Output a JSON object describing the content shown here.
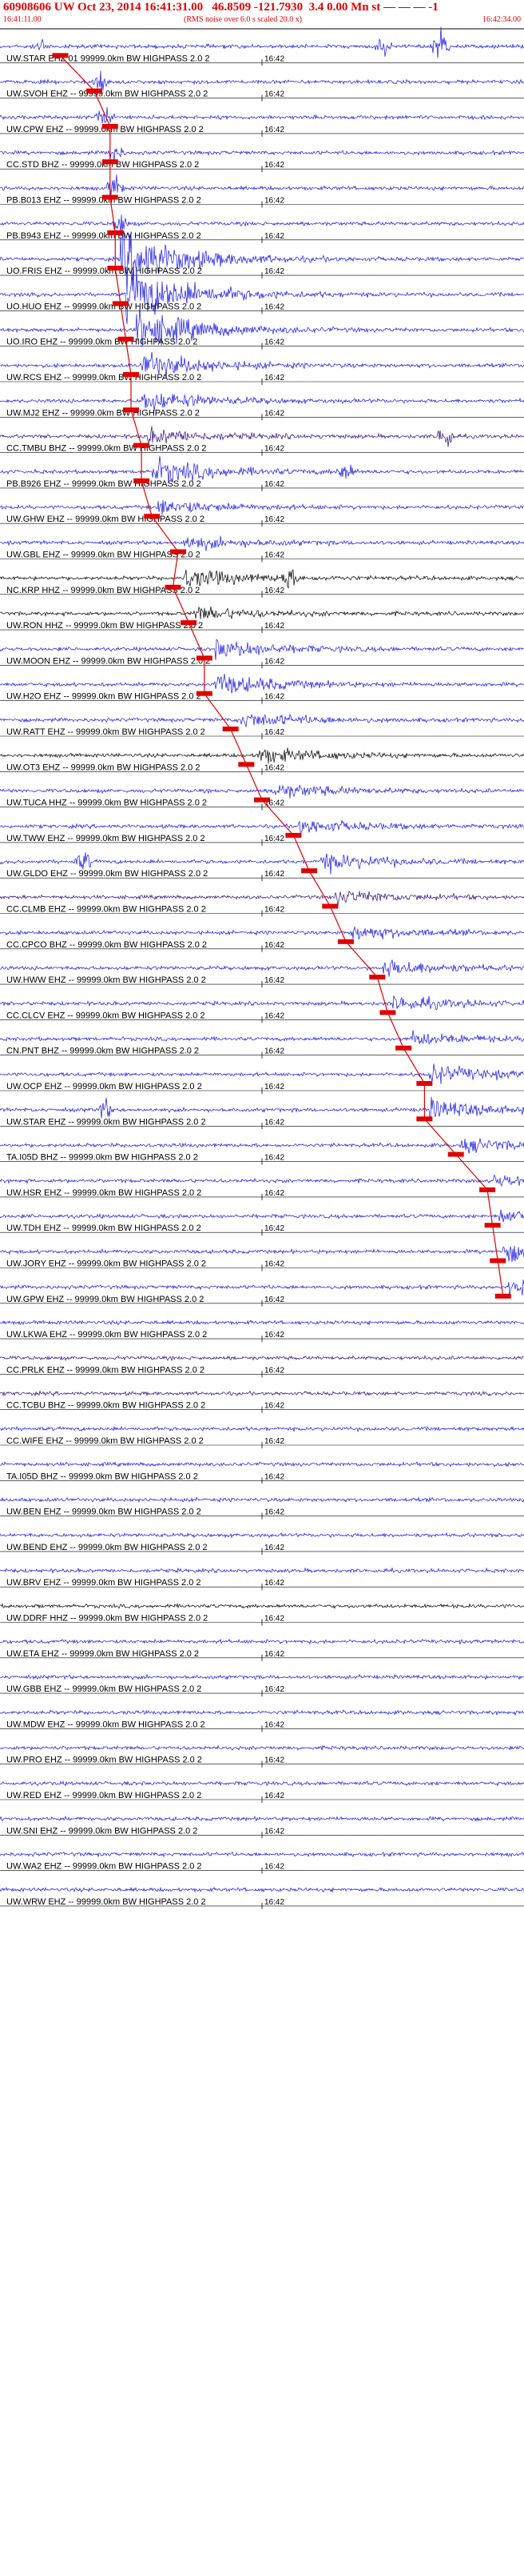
{
  "header": {
    "title": "60908606 UW Oct 23, 2014 16:41:31.00   46.8509 -121.7930  3.4 0.00 Mn st — — — -1",
    "start_time": "16:41:11.00",
    "scale_note": "(RMS noise over 6.0 s scaled 20.0 x)",
    "end_time": "16:42:34.00",
    "minute_mark": "16:42"
  },
  "chart_data": {
    "type": "line",
    "title": "60908606 UW Oct 23, 2014 16:41:31.00   46.8509 -121.7930  3.4 0.00 Mn st — — — -1",
    "xlim": [
      "16:41:11.00",
      "16:42:34.00"
    ],
    "tick_labels": [
      "16:42"
    ],
    "grid": true,
    "colors": {
      "trace": "#1515e6",
      "trace_alt": "#000000",
      "trace_dark": "#2a0a80",
      "pick": "#e00000",
      "text": "#e00000"
    },
    "series": [
      {
        "name": "UW.STAR EHZ 01 99999.0km BW  HIGHPASS  2.0  2",
        "color": "blue",
        "pick": 0.115,
        "events": [
          [
            0.08,
            0.9,
            "pulse"
          ],
          [
            0.84,
            2.6,
            "pulse"
          ],
          [
            0.73,
            1.2,
            "pulse"
          ]
        ]
      },
      {
        "name": "UW.SVOH EHZ -- 99999.0km BW  HIGHPASS  2.0  2",
        "color": "blue",
        "pick": 0.18,
        "events": [
          [
            0.19,
            1.6,
            "pulse"
          ]
        ]
      },
      {
        "name": "UW.CPW EHZ -- 99999.0km BW  HIGHPASS  2.0  2",
        "color": "blue",
        "pick": 0.21,
        "events": [
          [
            0.2,
            1.5,
            "pulse"
          ]
        ]
      },
      {
        "name": "CC.STD BHZ -- 99999.0km BW  HIGHPASS  2.0  2",
        "color": "blue",
        "pick": 0.21,
        "events": [
          [
            0.22,
            1.4,
            "pulse"
          ]
        ]
      },
      {
        "name": "PB.B013 EHZ -- 99999.0km BW  HIGHPASS  2.0  2",
        "color": "blue",
        "pick": 0.21,
        "events": [
          [
            0.22,
            1.6,
            "pulse"
          ]
        ]
      },
      {
        "name": "PB.B943 EHZ -- 99999.0km BW  HIGHPASS  2.0  2",
        "color": "blue",
        "pick": 0.22,
        "events": [
          [
            0.23,
            1.5,
            "pulse"
          ]
        ]
      },
      {
        "name": "UO.FRIS EHZ -- 99999.0km BW  HIGHPASS  2.0  2",
        "color": "blue",
        "pick": 0.22,
        "events": [
          [
            0.23,
            5,
            "coda"
          ]
        ]
      },
      {
        "name": "UO.HUO EHZ -- 99999.0km BW  HIGHPASS  2.0  2",
        "color": "blue",
        "pick": 0.23,
        "events": [
          [
            0.24,
            5,
            "coda"
          ]
        ]
      },
      {
        "name": "UO.IRO EHZ -- 99999.0km BW  HIGHPASS  2.0  2",
        "color": "blue",
        "pick": 0.24,
        "events": [
          [
            0.26,
            3.5,
            "coda"
          ]
        ]
      },
      {
        "name": "UW.RCS EHZ -- 99999.0km BW  HIGHPASS  2.0  2",
        "color": "blue",
        "pick": 0.25,
        "events": [
          [
            0.27,
            2.2,
            "coda"
          ]
        ]
      },
      {
        "name": "UW.MJ2 EHZ -- 99999.0km BW  HIGHPASS  2.0  2",
        "color": "blue",
        "pick": 0.25,
        "events": [
          [
            0.27,
            1.8,
            "coda"
          ]
        ]
      },
      {
        "name": "CC.TMBU BHZ -- 99999.0km BW  HIGHPASS  2.0  2",
        "color": "dark",
        "pick": 0.27,
        "events": [
          [
            0.28,
            1.3,
            "coda"
          ],
          [
            0.85,
            2.2,
            "pulse"
          ]
        ]
      },
      {
        "name": "PB.B926 EHZ -- 99999.0km BW  HIGHPASS  2.0  2",
        "color": "blue",
        "pick": 0.27,
        "events": [
          [
            0.29,
            2.2,
            "coda"
          ],
          [
            0.66,
            1.4,
            "pulse"
          ]
        ]
      },
      {
        "name": "UW.GHW EHZ -- 99999.0km BW  HIGHPASS  2.0  2",
        "color": "blue",
        "pick": 0.29,
        "events": [
          [
            0.3,
            1.3,
            "coda"
          ]
        ]
      },
      {
        "name": "UW.GBL EHZ -- 99999.0km BW  HIGHPASS  2.0  2",
        "color": "blue",
        "pick": 0.34,
        "events": [
          [
            0.35,
            1.1,
            "coda"
          ]
        ]
      },
      {
        "name": "NC.KRP HHZ -- 99999.0km BW  HIGHPASS  2.0  2",
        "color": "black",
        "pick": 0.33,
        "events": [
          [
            0.35,
            1.6,
            "coda"
          ],
          [
            0.55,
            1.4,
            "pulse"
          ]
        ]
      },
      {
        "name": "UW.RON HHZ -- 99999.0km BW  HIGHPASS  2.0  2",
        "color": "black",
        "pick": 0.36,
        "events": [
          [
            0.37,
            1.2,
            "coda"
          ]
        ]
      },
      {
        "name": "UW.MOON EHZ -- 99999.0km BW  HIGHPASS  2.0  2",
        "color": "blue",
        "pick": 0.39,
        "events": [
          [
            0.41,
            1.6,
            "coda"
          ]
        ]
      },
      {
        "name": "UW.H2O EHZ -- 99999.0km BW  HIGHPASS  2.0  2",
        "color": "blue",
        "pick": 0.39,
        "events": [
          [
            0.41,
            1.8,
            "coda"
          ]
        ]
      },
      {
        "name": "UW.RATT EHZ -- 99999.0km BW  HIGHPASS  2.0  2",
        "color": "blue",
        "pick": 0.44,
        "events": [
          [
            0.46,
            1.3,
            "coda"
          ]
        ]
      },
      {
        "name": "UW.OT3 EHZ -- 99999.0km BW  HIGHPASS  2.0  2",
        "color": "black",
        "pick": 0.47,
        "events": [
          [
            0.49,
            1.4,
            "coda"
          ]
        ]
      },
      {
        "name": "UW.TUCA HHZ -- 99999.0km BW  HIGHPASS  2.0  2",
        "color": "blue",
        "pick": 0.5,
        "events": [
          [
            0.52,
            1.3,
            "coda"
          ]
        ]
      },
      {
        "name": "UW.TWW EHZ -- 99999.0km BW  HIGHPASS  2.0  2",
        "color": "blue",
        "pick": 0.56,
        "events": [
          [
            0.57,
            1.2,
            "coda"
          ]
        ]
      },
      {
        "name": "UW.GLDO EHZ -- 99999.0km BW  HIGHPASS  2.0  2",
        "color": "blue",
        "pick": 0.59,
        "events": [
          [
            0.61,
            1.5,
            "coda"
          ],
          [
            0.16,
            1.4,
            "pulse"
          ]
        ]
      },
      {
        "name": "CC.CLMB EHZ -- 99999.0km BW  HIGHPASS  2.0  2",
        "color": "dark",
        "pick": 0.63,
        "events": [
          [
            0.64,
            1.2,
            "coda"
          ]
        ]
      },
      {
        "name": "CC.CPCO BHZ -- 99999.0km BW  HIGHPASS  2.0  2",
        "color": "blue",
        "pick": 0.66,
        "events": [
          [
            0.67,
            1.2,
            "coda"
          ]
        ]
      },
      {
        "name": "UW.HWW EHZ -- 99999.0km BW  HIGHPASS  2.0  2",
        "color": "blue",
        "pick": 0.72,
        "events": [
          [
            0.73,
            1.4,
            "coda"
          ]
        ]
      },
      {
        "name": "CC.CLCV EHZ -- 99999.0km BW  HIGHPASS  2.0  2",
        "color": "blue",
        "pick": 0.74,
        "events": [
          [
            0.75,
            1.2,
            "coda"
          ]
        ]
      },
      {
        "name": "CN.PNT BHZ -- 99999.0km BW  HIGHPASS  2.0  2",
        "color": "blue",
        "pick": 0.77,
        "events": [
          [
            0.78,
            1.1,
            "coda"
          ]
        ]
      },
      {
        "name": "UW.OCP EHZ -- 99999.0km BW  HIGHPASS  2.0  2",
        "color": "blue",
        "pick": 0.81,
        "events": [
          [
            0.82,
            1.5,
            "coda"
          ]
        ]
      },
      {
        "name": "UW.STAR EHZ -- 99999.0km BW  HIGHPASS  2.0  2",
        "color": "blue",
        "pick": 0.81,
        "events": [
          [
            0.82,
            1.6,
            "coda"
          ],
          [
            0.2,
            1.3,
            "pulse"
          ]
        ]
      },
      {
        "name": "TA.I05D BHZ -- 99999.0km BW  HIGHPASS  2.0  2",
        "color": "blue",
        "pick": 0.87,
        "events": [
          [
            0.88,
            1.1,
            "coda"
          ]
        ]
      },
      {
        "name": "UW.HSR EHZ -- 99999.0km BW  HIGHPASS  2.0  2",
        "color": "blue",
        "pick": 0.93,
        "events": [
          [
            0.94,
            1.1,
            "coda"
          ]
        ]
      },
      {
        "name": "UW.TDH EHZ -- 99999.0km BW  HIGHPASS  2.0  2",
        "color": "blue",
        "pick": 0.94,
        "events": [
          [
            0.95,
            1.1,
            "coda"
          ]
        ]
      },
      {
        "name": "UW.JORY EHZ -- 99999.0km BW  HIGHPASS  2.0  2",
        "color": "blue",
        "pick": 0.95,
        "events": [
          [
            0.96,
            1.6,
            "coda"
          ]
        ]
      },
      {
        "name": "UW.GPW EHZ -- 99999.0km BW  HIGHPASS  2.0  2",
        "color": "blue",
        "pick": 0.96,
        "events": [
          [
            0.97,
            1.8,
            "coda"
          ]
        ]
      },
      {
        "name": "UW.LKWA EHZ -- 99999.0km BW  HIGHPASS  2.0  2",
        "color": "blue",
        "pick": -1,
        "events": []
      },
      {
        "name": "CC.PRLK EHZ -- 99999.0km BW  HIGHPASS  2.0  2",
        "color": "dark",
        "pick": -1,
        "events": []
      },
      {
        "name": "CC.TCBU BHZ -- 99999.0km BW  HIGHPASS  2.0  2",
        "color": "dark",
        "pick": -1,
        "events": []
      },
      {
        "name": "CC.WIFE EHZ -- 99999.0km BW  HIGHPASS  2.0  2",
        "color": "blue",
        "pick": -1,
        "events": []
      },
      {
        "name": "TA.I05D BHZ -- 99999.0km BW  HIGHPASS  2.0  2",
        "color": "blue",
        "pick": -1,
        "events": []
      },
      {
        "name": "UW.BEN EHZ -- 99999.0km BW  HIGHPASS  2.0  2",
        "color": "blue",
        "pick": -1,
        "events": []
      },
      {
        "name": "UW.BEND EHZ -- 99999.0km BW  HIGHPASS  2.0  2",
        "color": "blue",
        "pick": -1,
        "events": []
      },
      {
        "name": "UW.BRV EHZ -- 99999.0km BW  HIGHPASS  2.0  2",
        "color": "blue",
        "pick": -1,
        "events": []
      },
      {
        "name": "UW.DDRF HHZ -- 99999.0km BW  HIGHPASS  2.0  2",
        "color": "black",
        "pick": -1,
        "events": []
      },
      {
        "name": "UW.ETA EHZ -- 99999.0km BW  HIGHPASS  2.0  2",
        "color": "blue",
        "pick": -1,
        "events": []
      },
      {
        "name": "UW.GBB EHZ -- 99999.0km BW  HIGHPASS  2.0  2",
        "color": "blue",
        "pick": -1,
        "events": []
      },
      {
        "name": "UW.MDW EHZ -- 99999.0km BW  HIGHPASS  2.0  2",
        "color": "blue",
        "pick": -1,
        "events": []
      },
      {
        "name": "UW.PRO EHZ -- 99999.0km BW  HIGHPASS  2.0  2",
        "color": "blue",
        "pick": -1,
        "events": []
      },
      {
        "name": "UW.RED EHZ -- 99999.0km BW  HIGHPASS  2.0  2",
        "color": "blue",
        "pick": -1,
        "events": []
      },
      {
        "name": "UW.SNI EHZ -- 99999.0km BW  HIGHPASS  2.0  2",
        "color": "blue",
        "pick": -1,
        "events": []
      },
      {
        "name": "UW.WA2 EHZ -- 99999.0km BW  HIGHPASS  2.0  2",
        "color": "blue",
        "pick": -1,
        "events": []
      },
      {
        "name": "UW.WRW EHZ -- 99999.0km BW  HIGHPASS  2.0  2",
        "color": "blue",
        "pick": -1,
        "events": []
      }
    ]
  }
}
